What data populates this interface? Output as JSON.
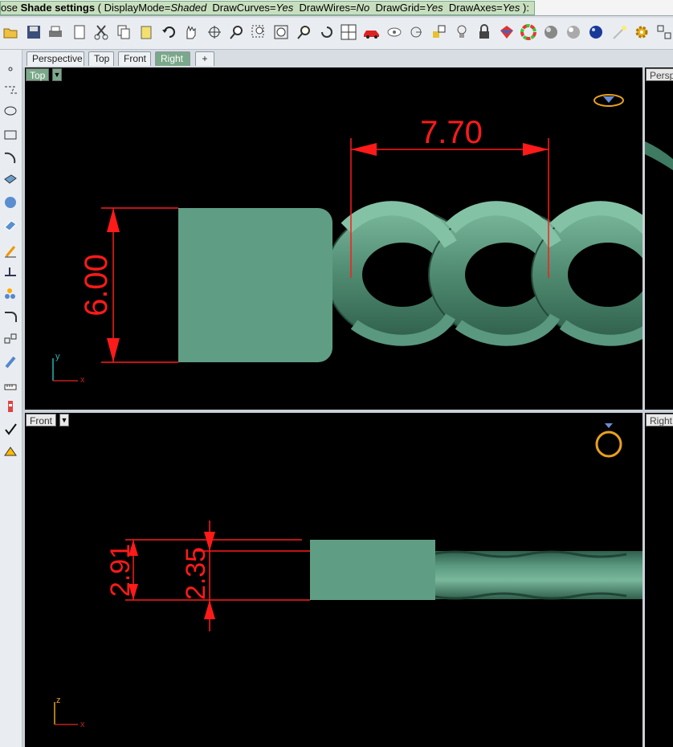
{
  "command_line": {
    "prefix": "ose ",
    "title": "Shade settings",
    "open_paren": " ( ",
    "options": [
      {
        "key": "DisplayMode=",
        "value": "Shaded"
      },
      {
        "key": "DrawCurves=",
        "value": "Yes"
      },
      {
        "key": "DrawWires=",
        "value": "No"
      },
      {
        "key": "DrawGrid=",
        "value": "Yes"
      },
      {
        "key": "DrawAxes=",
        "value": "Yes"
      }
    ],
    "close": " ):"
  },
  "toolbar": {
    "icons": [
      "open-icon",
      "save-icon",
      "print-icon",
      "import-icon",
      "cut-icon",
      "copy-icon",
      "paste-icon",
      "undo-icon",
      "pan-icon",
      "rotate-view-icon",
      "zoom-icon",
      "zoom-window-icon",
      "zoom-extents-icon",
      "zoom-selected-icon",
      "undo-view-icon",
      "four-viewports-icon",
      "car-icon",
      "hide-icon",
      "snap-icon",
      "layer-icon",
      "light-bulb-icon",
      "lock-icon",
      "paint-icon",
      "color-wheel-icon",
      "render-sphere-icon",
      "render-preview-icon",
      "material-sphere-icon",
      "light-icon",
      "gear-icon",
      "options-icon"
    ]
  },
  "tabs": [
    {
      "label": "Perspective",
      "active": false
    },
    {
      "label": "Top",
      "active": false
    },
    {
      "label": "Front",
      "active": false
    },
    {
      "label": "Right",
      "active": true
    },
    {
      "label": "+",
      "active": false
    }
  ],
  "viewports": {
    "top": {
      "label": "Top",
      "axis_y": "y",
      "axis_x": "x"
    },
    "front": {
      "label": "Front",
      "axis_z": "z",
      "axis_x": "x"
    },
    "perspective_side": {
      "label": "Persp"
    },
    "right_side": {
      "label": "Right"
    }
  },
  "dimensions": {
    "top_width": "7.70",
    "top_height": "6.00",
    "front_outer": "2.91",
    "front_inner": "2.35"
  },
  "colors": {
    "model": "#5f9e84",
    "model_dark": "#3a6f5a",
    "dimension": "#ff1a1a",
    "viewport_bg": "#000000",
    "active_tab": "#7aa88a"
  }
}
